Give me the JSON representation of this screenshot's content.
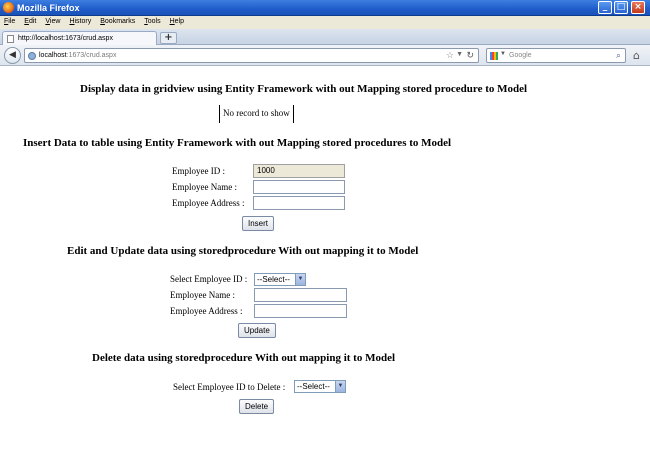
{
  "window": {
    "title": "Mozilla Firefox"
  },
  "menu": [
    {
      "label": "File",
      "u": "F",
      "rest": "ile"
    },
    {
      "label": "Edit",
      "u": "E",
      "rest": "dit"
    },
    {
      "label": "View",
      "u": "V",
      "rest": "iew"
    },
    {
      "label": "History",
      "u": "H",
      "rest": "istory"
    },
    {
      "label": "Bookmarks",
      "u": "B",
      "rest": "ookmarks"
    },
    {
      "label": "Tools",
      "u": "T",
      "rest": "ools"
    },
    {
      "label": "Help",
      "u": "H",
      "rest": "elp"
    }
  ],
  "tab": {
    "label": "http://localhost:1673/crud.aspx",
    "new_tab": "+"
  },
  "address": {
    "host": "localhost",
    "path": ":1673/crud.aspx"
  },
  "search": {
    "placeholder": "Google"
  },
  "page": {
    "display_heading": "Display data in gridview using Entity Framework with out Mapping stored procedure to Model",
    "no_record": "No record to show",
    "insert_heading": "Insert Data to table using Entity Framework with out Mapping stored procedures to Model",
    "insert": {
      "emp_id_label": "Employee ID :",
      "emp_id_value": "1000",
      "emp_name_label": "Employee Name :",
      "emp_name_value": "",
      "emp_address_label": "Employee Address :",
      "emp_address_value": "",
      "button": "Insert"
    },
    "edit_heading": "Edit and Update data using storedprocedure With out mapping it to Model",
    "edit": {
      "select_label": "Select Employee ID :",
      "select_value": "--Select--",
      "emp_name_label": "Employee Name :",
      "emp_name_value": "",
      "emp_address_label": "Employee Address :",
      "emp_address_value": "",
      "button": "Update"
    },
    "delete_heading": "Delete data using storedprocedure With out mapping it to Model",
    "delete": {
      "select_label": "Select Employee ID to Delete :",
      "select_value": "--Select--",
      "button": "Delete"
    }
  }
}
